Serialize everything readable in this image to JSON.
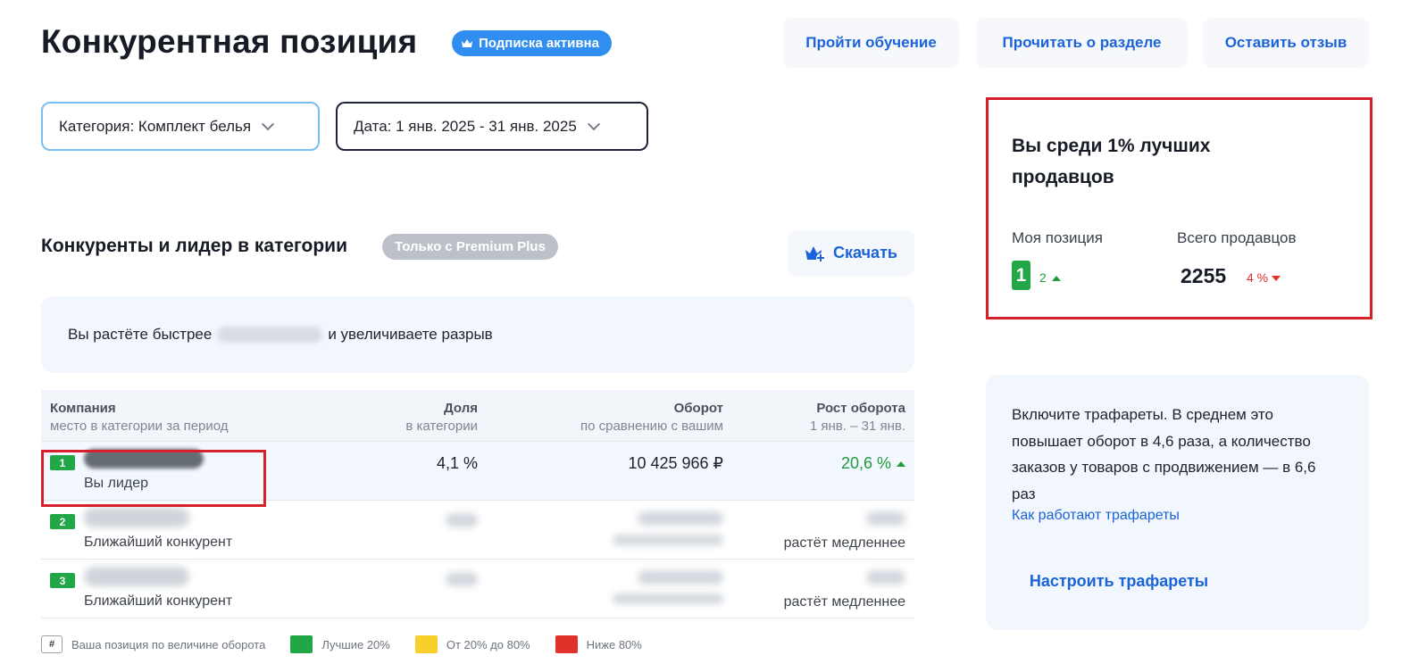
{
  "header": {
    "title": "Конкурентная позиция",
    "subscription_badge": "Подписка активна",
    "buttons": {
      "training": "Пройти обучение",
      "read_about": "Прочитать о разделе",
      "feedback": "Оставить отзыв"
    }
  },
  "filters": {
    "category": "Категория: Комплект белья",
    "date": "Дата: 1 янв. 2025 - 31 янв. 2025"
  },
  "section": {
    "title": "Конкуренты и лидер в категории",
    "premium_badge": "Только с Premium Plus",
    "download": "Скачать",
    "insight_before": "Вы растёте быстрее",
    "insight_after": "и увеличиваете разрыв"
  },
  "table": {
    "columns": [
      {
        "title": "Компания",
        "subtitle": "место в категории за период"
      },
      {
        "title": "Доля",
        "subtitle": "в категории"
      },
      {
        "title": "Оборот",
        "subtitle": "по сравнению с вашим"
      },
      {
        "title": "Рост оборота",
        "subtitle": "1 янв. – 31 янв."
      }
    ],
    "rows": [
      {
        "rank": "1",
        "subtitle": "Вы лидер",
        "share": "4,1 %",
        "turnover": "10 425 966 ₽",
        "growth": "20,6 %"
      },
      {
        "rank": "2",
        "subtitle": "Ближайший конкурент",
        "growth_note": "растёт медленнее"
      },
      {
        "rank": "3",
        "subtitle": "Ближайший конкурент",
        "growth_note": "растёт медленнее"
      }
    ]
  },
  "legend": {
    "hash": "#",
    "position": "Ваша позиция по величине оборота",
    "top": "Лучшие 20%",
    "mid": "От 20% до 80%",
    "low": "Ниже 80%",
    "colors": {
      "top": "#21a747",
      "mid": "#f9d02b",
      "low": "#e0322b"
    }
  },
  "seller_card": {
    "title": "Вы среди 1% лучших продавцов",
    "my_position_label": "Моя позиция",
    "my_position": "1",
    "my_position_delta": "2",
    "total_label": "Всего продавцов",
    "total": "2255",
    "total_delta": "4 %"
  },
  "promo": {
    "text": "Включите трафареты. В среднем это повышает оборот в 4,6 раза, а количество заказов у товаров с продвижением — в 6,6 раз",
    "link": "Как работают трафареты",
    "button": "Настроить трафареты"
  },
  "colors": {
    "accent": "#1a63d8",
    "success": "#21a747",
    "danger": "#e0322b",
    "highlight": "#d6212c"
  }
}
